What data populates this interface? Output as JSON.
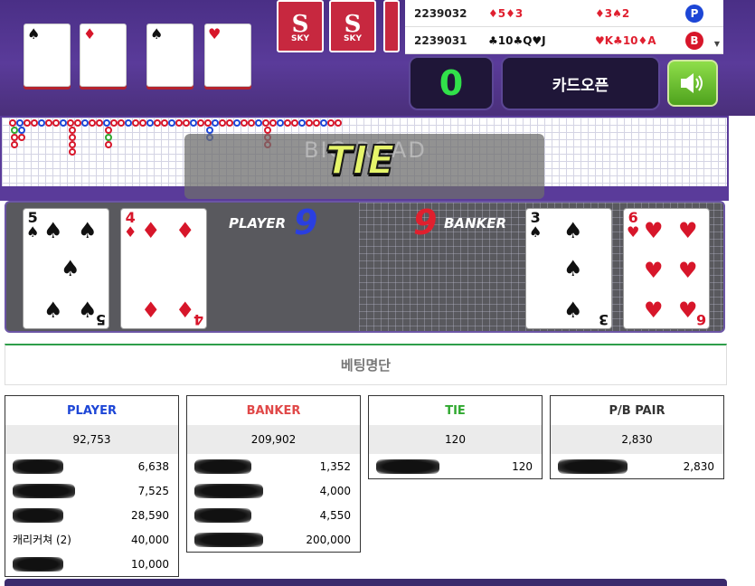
{
  "history": [
    {
      "id": "2239032",
      "player_cards": "♦5♦3",
      "banker_cards": "♦3♠2",
      "result": "P"
    },
    {
      "id": "2239031",
      "player_cards": "♣10♣Q♥J",
      "banker_cards": "♥K♣10♦A",
      "result": "B"
    }
  ],
  "controls": {
    "card_count": "0",
    "open_button": "카드오픈"
  },
  "shoe_label": "SKY",
  "overlay": {
    "result_text": "TIE",
    "ghost_text": "BIG ROAD"
  },
  "player": {
    "label": "PLAYER",
    "score": "9",
    "cards": [
      {
        "rank": "5",
        "suit": "♠"
      },
      {
        "rank": "4",
        "suit": "♦"
      }
    ]
  },
  "banker": {
    "label": "BANKER",
    "score": "9",
    "cards": [
      {
        "rank": "3",
        "suit": "♠"
      },
      {
        "rank": "6",
        "suit": "♥"
      }
    ]
  },
  "betting": {
    "title": "베팅명단",
    "columns": [
      {
        "name": "PLAYER",
        "color": "#1d46d6",
        "total": "92,753",
        "rows": [
          {
            "user": "",
            "amount": "6,638"
          },
          {
            "user": "",
            "amount": "7,525"
          },
          {
            "user": "",
            "amount": "28,590"
          },
          {
            "user": "캐리커쳐 (2)",
            "amount": "40,000"
          },
          {
            "user": "",
            "amount": "10,000"
          }
        ]
      },
      {
        "name": "BANKER",
        "color": "#e04848",
        "total": "209,902",
        "rows": [
          {
            "user": "",
            "amount": "1,352"
          },
          {
            "user": "",
            "amount": "4,000"
          },
          {
            "user": "",
            "amount": "4,550"
          },
          {
            "user": "",
            "amount": "200,000"
          }
        ]
      },
      {
        "name": "TIE",
        "color": "#2fa82f",
        "total": "120",
        "rows": [
          {
            "user": "",
            "amount": "120"
          }
        ]
      },
      {
        "name": "P/B PAIR",
        "color": "#333333",
        "total": "2,830",
        "rows": [
          {
            "user": "",
            "amount": "2,830"
          }
        ]
      }
    ]
  }
}
